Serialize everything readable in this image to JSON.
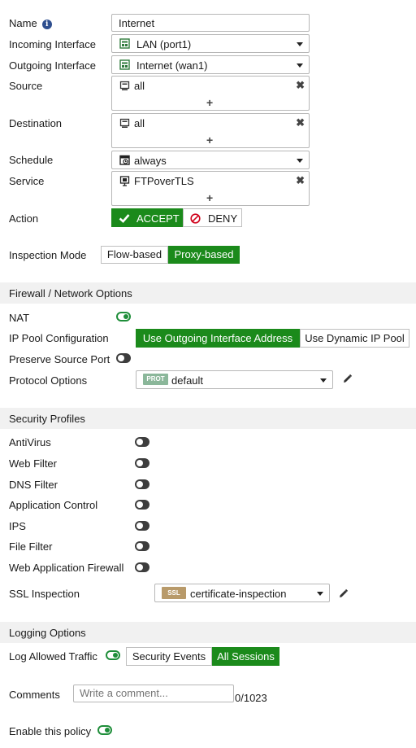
{
  "policy": {
    "name_label": "Name",
    "name_value": "Internet",
    "incoming_label": "Incoming Interface",
    "incoming_value": "LAN (port1)",
    "outgoing_label": "Outgoing Interface",
    "outgoing_value": "Internet (wan1)",
    "source_label": "Source",
    "source_value": "all",
    "destination_label": "Destination",
    "destination_value": "all",
    "schedule_label": "Schedule",
    "schedule_value": "always",
    "service_label": "Service",
    "service_value": "FTPoverTLS",
    "plus_glyph": "+",
    "remove_glyph": "✖",
    "action_label": "Action",
    "accept_label": "ACCEPT",
    "deny_label": "DENY",
    "inspection_label": "Inspection Mode",
    "flow_label": "Flow-based",
    "proxy_label": "Proxy-based",
    "selected_action": "ACCEPT",
    "selected_inspection_mode": "Proxy-based"
  },
  "firewall": {
    "section_title": "Firewall / Network Options",
    "nat_label": "NAT",
    "nat_enabled": true,
    "ip_pool_label": "IP Pool Configuration",
    "ip_pool_outgoing": "Use Outgoing Interface Address",
    "ip_pool_dynamic": "Use Dynamic IP Pool",
    "ip_pool_selected": "Use Outgoing Interface Address",
    "preserve_port_label": "Preserve Source Port",
    "preserve_port_enabled": false,
    "protocol_label": "Protocol Options",
    "protocol_badge": "PROT",
    "protocol_value": "default"
  },
  "security": {
    "section_title": "Security Profiles",
    "profiles": [
      {
        "label": "AntiVirus",
        "enabled": false
      },
      {
        "label": "Web Filter",
        "enabled": false
      },
      {
        "label": "DNS Filter",
        "enabled": false
      },
      {
        "label": "Application Control",
        "enabled": false
      },
      {
        "label": "IPS",
        "enabled": false
      },
      {
        "label": "File Filter",
        "enabled": false
      },
      {
        "label": "Web Application Firewall",
        "enabled": false
      }
    ],
    "ssl_label": "SSL Inspection",
    "ssl_badge": "SSL",
    "ssl_value": "certificate-inspection"
  },
  "logging": {
    "section_title": "Logging Options",
    "log_label": "Log Allowed Traffic",
    "log_enabled": true,
    "security_events": "Security Events",
    "all_sessions": "All Sessions",
    "log_selected": "All Sessions",
    "comments_label": "Comments",
    "comments_placeholder": "Write a comment...",
    "comments_count": "0/1023",
    "enable_label": "Enable this policy",
    "enable_enabled": true
  },
  "colors": {
    "accent_green": "#1b8a1b",
    "toggle_on": "#1f8e3a",
    "deny_red": "#d0021b",
    "info_blue": "#2f4f8f",
    "prot_badge": "#8bb79a",
    "ssl_badge": "#b89a6a"
  },
  "icons": {
    "name_info": "info-icon",
    "incoming": "interface-icon",
    "outgoing": "interface-icon",
    "source": "address-icon",
    "destination": "address-icon",
    "schedule": "schedule-icon",
    "service": "service-icon",
    "accept": "checkmark-icon",
    "deny": "deny-icon",
    "edit": "pencil-icon"
  }
}
